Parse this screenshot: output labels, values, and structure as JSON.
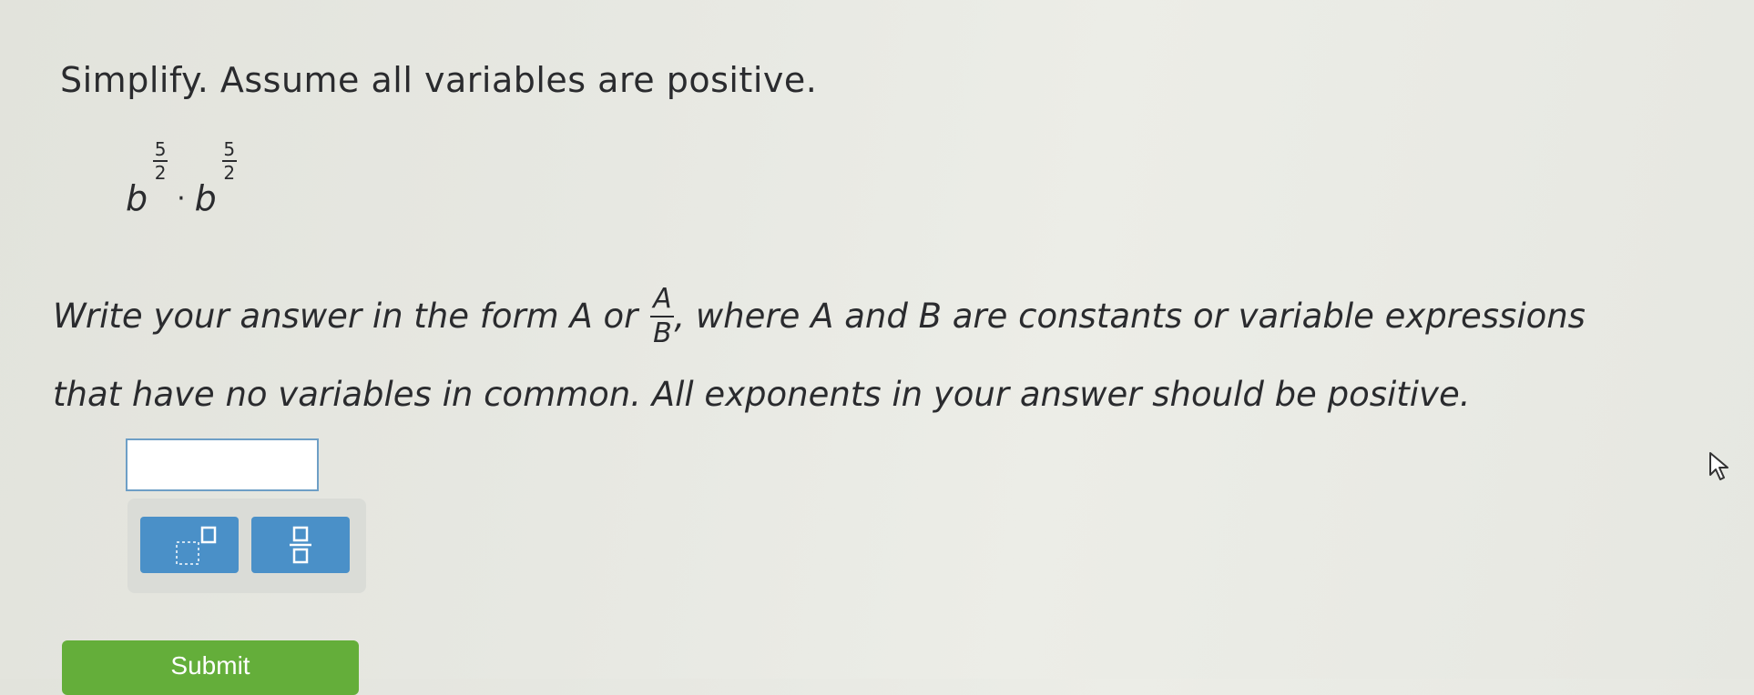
{
  "instruction": "Simplify. Assume all variables are positive.",
  "expression": {
    "base1": "b",
    "exp1_num": "5",
    "exp1_den": "2",
    "operator": "·",
    "base2": "b",
    "exp2_num": "5",
    "exp2_den": "2"
  },
  "answer_instructions": {
    "line1_before": "Write your answer in the form A or",
    "frac_num": "A",
    "frac_den": "B",
    "line1_after": ", where A and B are constants or variable expressions",
    "line2": "that have no variables in common. All exponents in your answer should be positive."
  },
  "answer": {
    "value": ""
  },
  "tools": {
    "exponent_icon": "exponent-template-icon",
    "fraction_icon": "fraction-template-icon"
  },
  "submit_label": "Submit",
  "colors": {
    "tool_button": "#4a90c8",
    "submit_button": "#64ae3a",
    "answer_border": "#6e9fc6"
  }
}
